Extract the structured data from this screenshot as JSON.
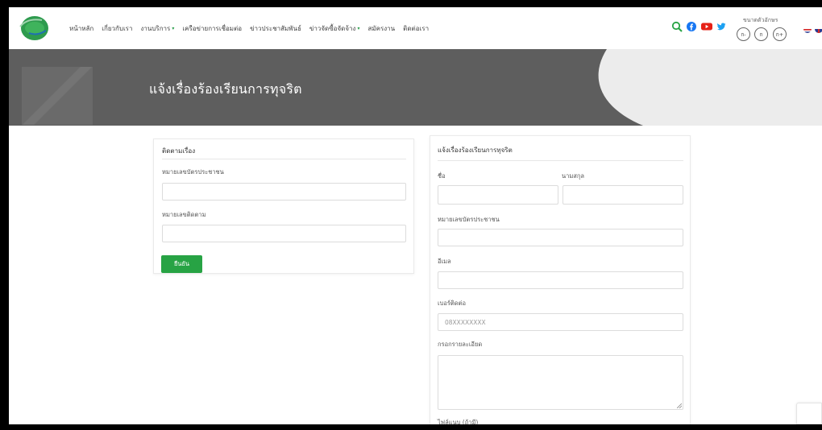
{
  "header": {
    "nav": [
      {
        "label": "หน้าหลัก",
        "dropdown": false
      },
      {
        "label": "เกี่ยวกับเรา",
        "dropdown": false
      },
      {
        "label": "งานบริการ",
        "dropdown": true
      },
      {
        "label": "เครือข่ายการเชื่อมต่อ",
        "dropdown": false
      },
      {
        "label": "ข่าวประชาสัมพันธ์",
        "dropdown": false
      },
      {
        "label": "ข่าวจัดซื้อจัดจ้าง",
        "dropdown": true
      },
      {
        "label": "สมัครงาน",
        "dropdown": false
      },
      {
        "label": "ติดต่อเรา",
        "dropdown": false
      }
    ],
    "font_size_label": "ขนาดตัวอักษร",
    "font_buttons": [
      "ก-",
      "ก",
      "ก+"
    ],
    "accent_color": "#27a344"
  },
  "banner": {
    "title": "แจ้งเรื่องร้องเรียนการทุจริต"
  },
  "track_form": {
    "title": "ติดตามเรื่อง",
    "id_card_label": "หมายเลขบัตรประชาชน",
    "id_card_value": "",
    "tracking_label": "หมายเลขติดตาม",
    "tracking_value": "",
    "submit_label": "ยืนยัน"
  },
  "complaint_form": {
    "title": "แจ้งเรื่องร้องเรียนการทุจริต",
    "first_name_label": "ชื่อ",
    "first_name_value": "",
    "last_name_label": "นามสกุล",
    "last_name_value": "",
    "id_card_label": "หมายเลขบัตรประชาชน",
    "id_card_value": "",
    "email_label": "อีเมล",
    "email_value": "",
    "phone_label": "เบอร์ติดต่อ",
    "phone_placeholder": "08XXXXXXXX",
    "detail_label": "กรอกรายละเอียด",
    "detail_value": "",
    "file_label": "ไฟล์แนบ (ถ้ามี)"
  }
}
